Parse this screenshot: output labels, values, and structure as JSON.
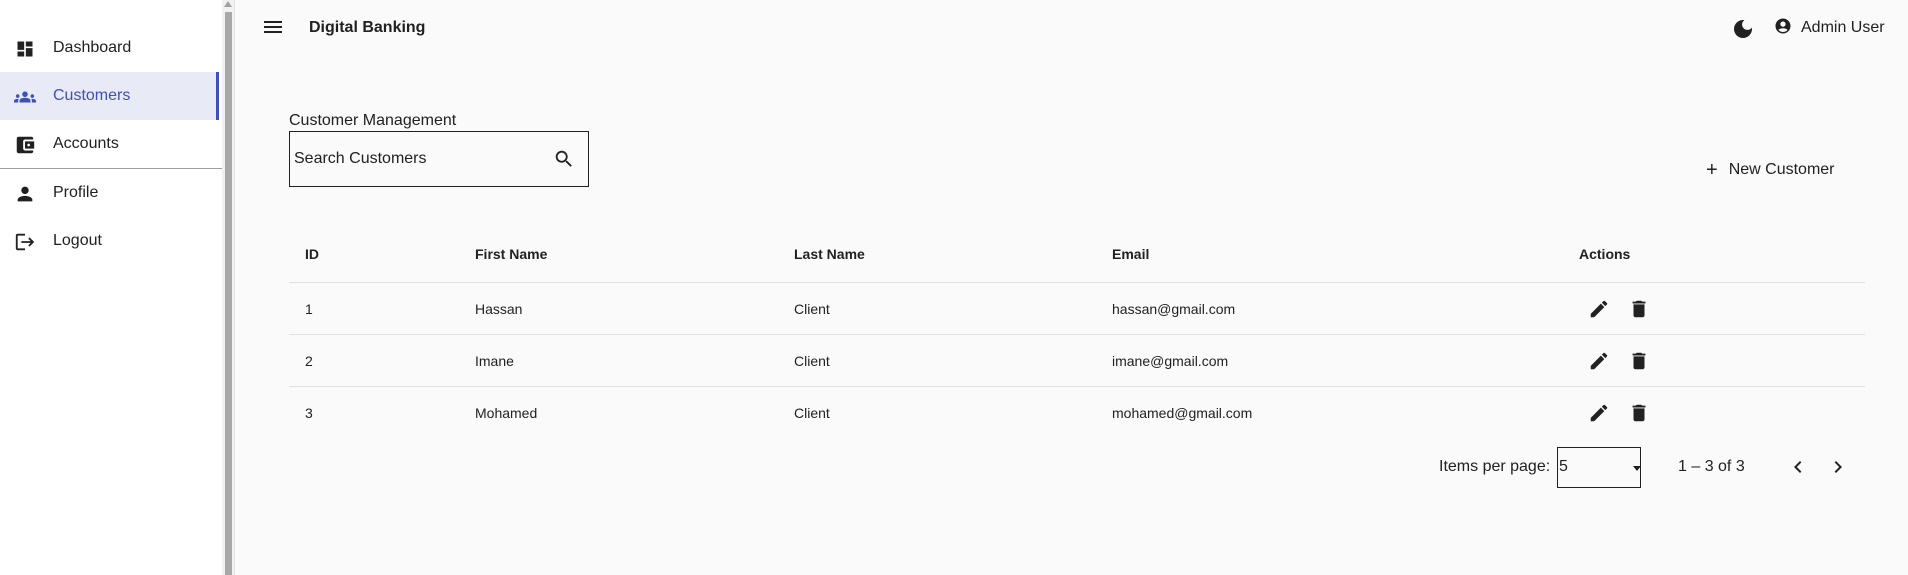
{
  "sidebar": {
    "items": [
      {
        "label": "Dashboard",
        "icon": "dashboard-icon"
      },
      {
        "label": "Customers",
        "icon": "group-icon",
        "active": true
      },
      {
        "label": "Accounts",
        "icon": "wallet-icon"
      },
      {
        "label": "Profile",
        "icon": "person-icon"
      },
      {
        "label": "Logout",
        "icon": "logout-icon"
      }
    ]
  },
  "header": {
    "title": "Digital Banking",
    "user_label": "Admin User",
    "icons": [
      "menu-icon",
      "dark-mode-icon",
      "account-circle-icon"
    ]
  },
  "main": {
    "section_title": "Customer Management",
    "search": {
      "placeholder": "Search Customers",
      "icon": "search-icon"
    },
    "new_button_label": "New Customer"
  },
  "table": {
    "headers": {
      "id": "ID",
      "first_name": "First Name",
      "last_name": "Last Name",
      "email": "Email",
      "actions": "Actions"
    },
    "rows": [
      {
        "id": "1",
        "first_name": "Hassan",
        "last_name": "Client",
        "email": "hassan@gmail.com"
      },
      {
        "id": "2",
        "first_name": "Imane",
        "last_name": "Client",
        "email": "imane@gmail.com"
      },
      {
        "id": "3",
        "first_name": "Mohamed",
        "last_name": "Client",
        "email": "mohamed@gmail.com"
      }
    ],
    "action_icons": [
      "edit-icon",
      "delete-icon"
    ]
  },
  "paginator": {
    "items_per_page_label": "Items per page:",
    "page_size": "5",
    "range_label": "1 – 3 of 3"
  },
  "colors": {
    "accent": "#3f51b5",
    "active_bg": "#e8eaf6",
    "background": "#fafafa"
  }
}
